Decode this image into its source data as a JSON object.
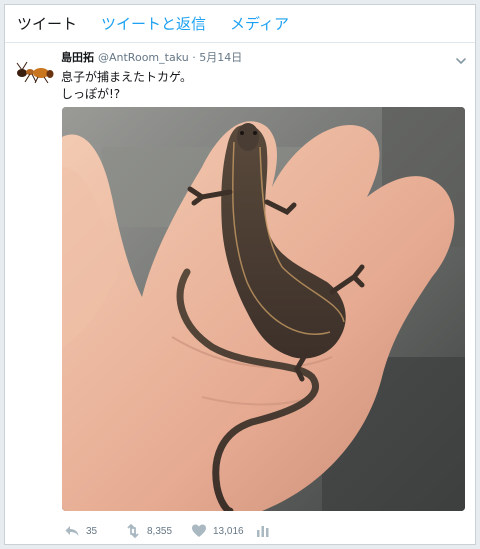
{
  "tabs": [
    {
      "label": "ツイート"
    },
    {
      "label": "ツイートと返信"
    },
    {
      "label": "メディア"
    }
  ],
  "tweet": {
    "name": "島田拓",
    "handle": "@AntRoom_taku",
    "separator": "·",
    "date": "5月14日",
    "text_lines": [
      "息子が捕まえたトカゲ。",
      "しっぽが!?"
    ],
    "actions": {
      "reply_count": "35",
      "retweet_count": "8,355",
      "like_count": "13,016"
    }
  },
  "colors": {
    "accent": "#1da1f2",
    "text": "#14171a",
    "muted": "#657786"
  },
  "icons": {
    "avatar": "ant-avatar",
    "caret": "chevron-down-icon",
    "reply": "reply-icon",
    "retweet": "retweet-icon",
    "like": "heart-icon",
    "stats": "analytics-icon"
  }
}
